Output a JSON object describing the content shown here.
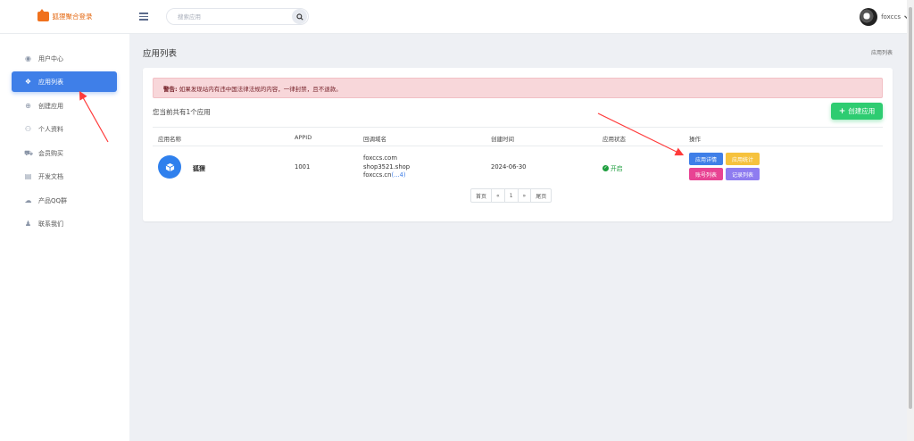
{
  "brand": {
    "title": "狐狸聚合登录"
  },
  "search": {
    "placeholder": "搜索应用"
  },
  "user": {
    "name": "foxccs",
    "chevron": "chevron-down-icon"
  },
  "sidebar": {
    "items": [
      {
        "label": "用户中心",
        "icon": "user-circle-icon",
        "active": false
      },
      {
        "label": "应用列表",
        "icon": "cubes-icon",
        "active": true
      },
      {
        "label": "创建应用",
        "icon": "plus-circle-icon",
        "active": false
      },
      {
        "label": "个人资料",
        "icon": "users-icon",
        "active": false
      },
      {
        "label": "会员购买",
        "icon": "cart-icon",
        "active": false
      },
      {
        "label": "开发文档",
        "icon": "book-icon",
        "active": false
      },
      {
        "label": "产品QQ群",
        "icon": "chat-icon",
        "active": false
      },
      {
        "label": "联系我们",
        "icon": "bell-icon",
        "active": false
      }
    ]
  },
  "page": {
    "title": "应用列表",
    "breadcrumb": "应用列表"
  },
  "alert": {
    "label": "警告:",
    "text": "如果发现站内有违中国法律法规的内容，一律封禁，且不退款。"
  },
  "summary": {
    "text": "您当前共有1个应用"
  },
  "create_button": {
    "label": "创建应用"
  },
  "table": {
    "headers": [
      "应用名称",
      "APPID",
      "回调域名",
      "创建时间",
      "应用状态",
      "操作"
    ],
    "rows": [
      {
        "name": "狐狸",
        "appid": "1001",
        "domains": [
          "foxccs.com",
          "shop3521.shop",
          "foxccs.cn"
        ],
        "domains_more": "(...4)",
        "created": "2024-06-30",
        "status": "开启",
        "actions": [
          "应用详情",
          "应用统计",
          "账号列表",
          "记录列表"
        ]
      }
    ]
  },
  "pagination": {
    "first": "首页",
    "prev": "«",
    "current": "1",
    "next": "»",
    "last": "尾页"
  },
  "colors": {
    "primary": "#3f7fe8",
    "success": "#2ecc71",
    "alert_bg": "#f8d7da",
    "arrow": "#ff3b3b"
  }
}
